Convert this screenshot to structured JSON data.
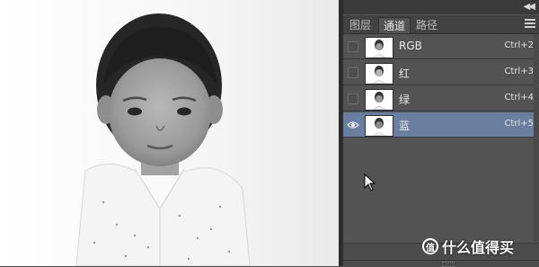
{
  "panel": {
    "tabs": [
      {
        "label": "图层",
        "active": false
      },
      {
        "label": "通道",
        "active": true
      },
      {
        "label": "路径",
        "active": false
      }
    ],
    "channels": [
      {
        "label": "RGB",
        "shortcut": "Ctrl+2",
        "visible": false,
        "selected": false
      },
      {
        "label": "红",
        "shortcut": "Ctrl+3",
        "visible": false,
        "selected": false
      },
      {
        "label": "绿",
        "shortcut": "Ctrl+4",
        "visible": false,
        "selected": false
      },
      {
        "label": "蓝",
        "shortcut": "Ctrl+5",
        "visible": true,
        "selected": true
      }
    ]
  },
  "watermark": {
    "badge": "值",
    "text": "什么值得买"
  },
  "colors": {
    "panel_bg": "#535353",
    "selected_row": "#6a7fa0",
    "tab_bar": "#424242"
  },
  "icons": {
    "collapse": "double-chevron-right-icon",
    "panel_menu": "hamburger-menu-icon",
    "visibility": "eye-icon",
    "cursor": "mouse-pointer-icon"
  }
}
